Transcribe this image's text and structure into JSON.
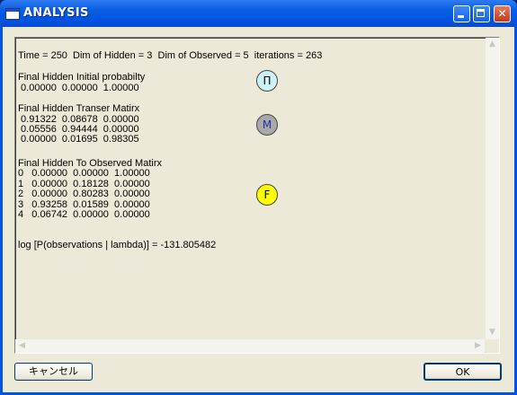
{
  "window": {
    "title": "ANALYSIS"
  },
  "report": {
    "header_line": "Time = 250  Dim of Hidden = 3  Dim of Observed = 5  iterations = 263",
    "initial_title": "Final Hidden Initial probabilty",
    "initial_row": " 0.00000  0.00000  1.00000",
    "transfer_title": "Final Hidden Transer Matirx",
    "transfer_rows": [
      " 0.91322  0.08678  0.00000",
      " 0.05556  0.94444  0.00000",
      " 0.00000  0.01695  0.98305"
    ],
    "observed_title": "Final Hidden To Observed Matirx",
    "observed_rows": [
      "0   0.00000  0.00000  1.00000",
      "1   0.00000  0.18128  0.00000",
      "2   0.00000  0.80283  0.00000",
      "3   0.93258  0.01589  0.00000",
      "4   0.06742  0.00000  0.00000"
    ],
    "log_line": "log [P(observations | lambda)] = -131.805482"
  },
  "nodes": {
    "pi_label": "Π",
    "m_label": "M",
    "f_label": "F"
  },
  "colors": {
    "pi_fill": "#cdf2f8",
    "m_fill": "#a9a9a9",
    "f_fill": "#ffff00"
  },
  "buttons": {
    "cancel_label": "キャンセル",
    "ok_label": "OK"
  },
  "icons": {
    "minimize": "minimize-icon",
    "maximize": "maximize-icon",
    "close": "close-icon",
    "scroll_up": "scroll-up-icon",
    "scroll_down": "scroll-down-icon",
    "scroll_left": "scroll-left-icon",
    "scroll_right": "scroll-right-icon"
  }
}
